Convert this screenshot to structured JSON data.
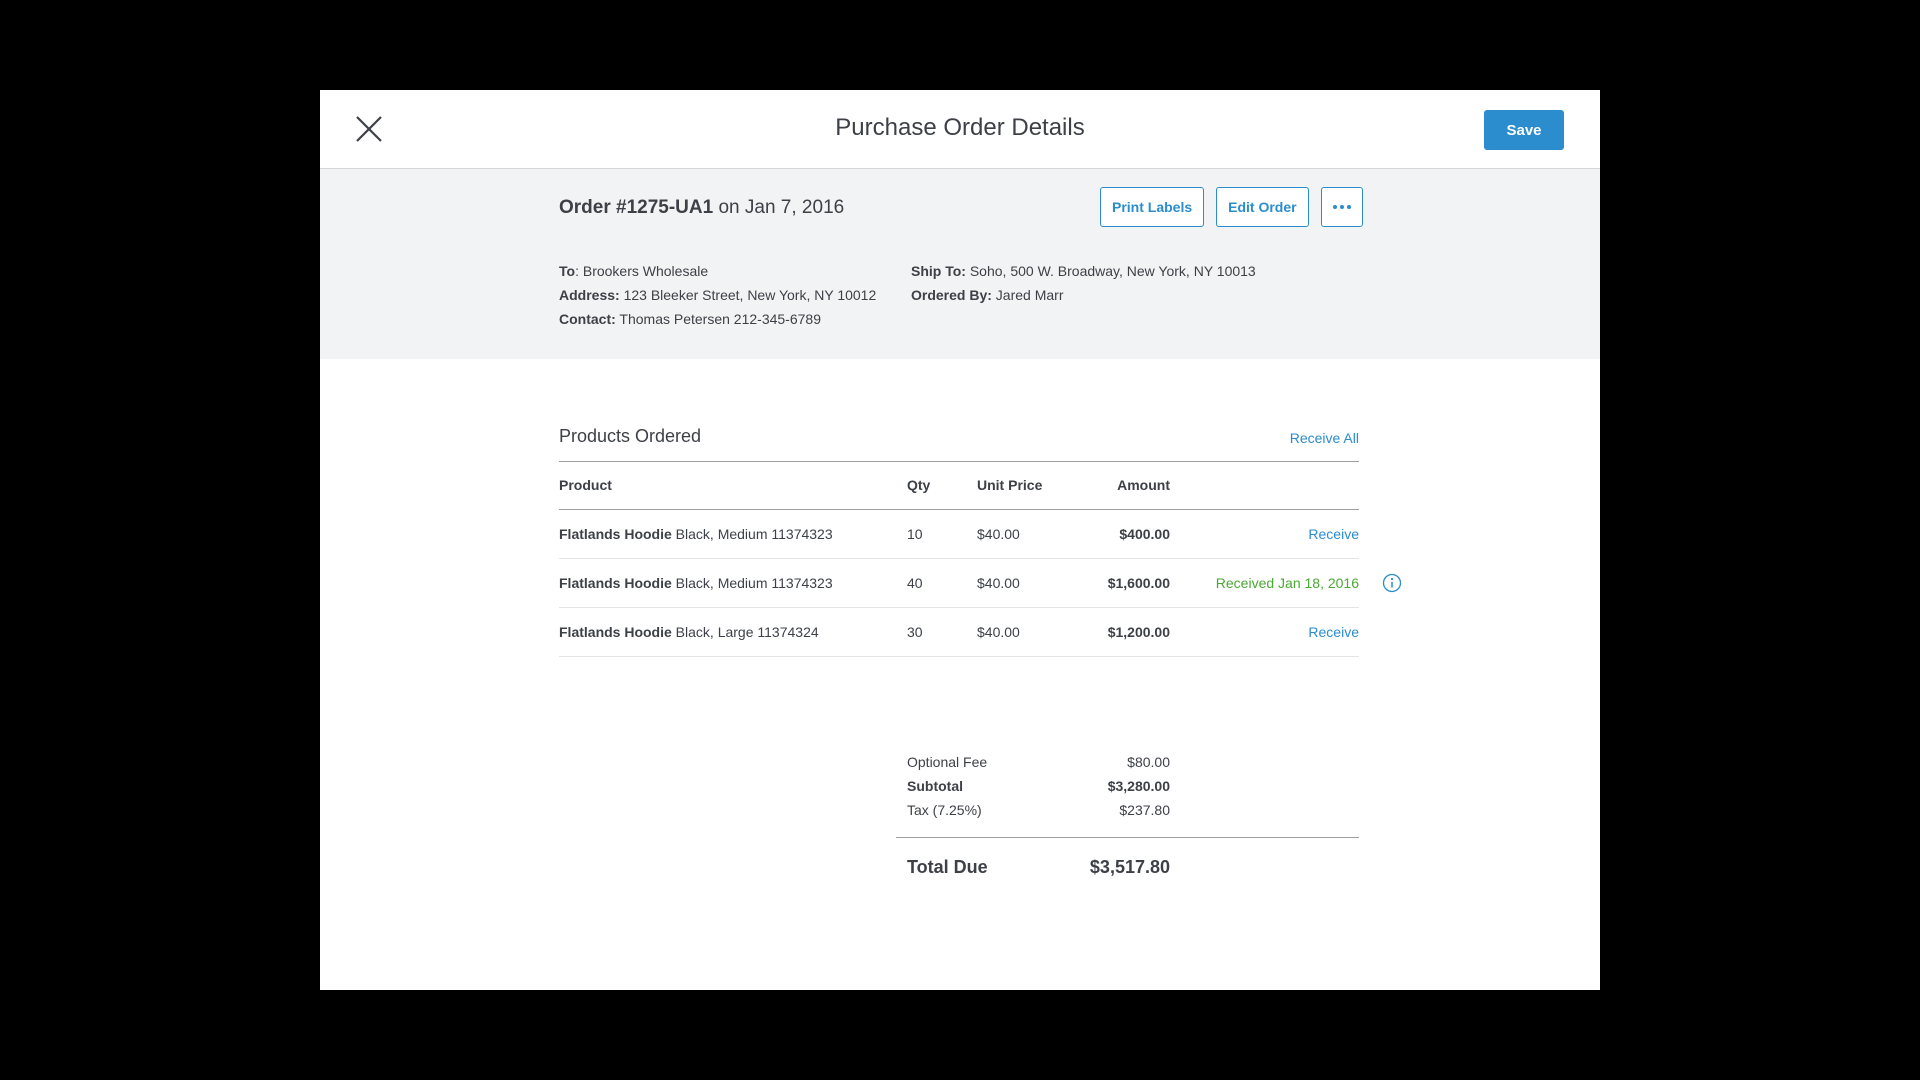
{
  "modal": {
    "title": "Purchase Order Details",
    "save_label": "Save"
  },
  "order": {
    "number": "Order #1275-UA1",
    "date_text": " on Jan 7, 2016",
    "buttons": {
      "print_labels": "Print Labels",
      "edit_order": "Edit Order"
    },
    "details_left": [
      {
        "label": "To",
        "value": ": Brookers Wholesale"
      },
      {
        "label": "Address:",
        "value": " 123 Bleeker Street, New York, NY 10012"
      },
      {
        "label": "Contact:",
        "value": " Thomas Petersen 212-345-6789"
      }
    ],
    "details_right": [
      {
        "label": "Ship To:",
        "value": " Soho, 500 W. Broadway, New York, NY 10013"
      },
      {
        "label": "Ordered By:",
        "value": " Jared Marr"
      }
    ]
  },
  "products": {
    "title": "Products Ordered",
    "receive_all": "Receive All",
    "columns": {
      "product": "Product",
      "qty": "Qty",
      "unit_price": "Unit Price",
      "amount": "Amount"
    },
    "rows": [
      {
        "name": "Flatlands Hoodie",
        "variant": " Black, Medium 11374323",
        "qty": "10",
        "unit_price": "$40.00",
        "amount": "$400.00",
        "action": "Receive"
      },
      {
        "name": "Flatlands Hoodie",
        "variant": " Black, Medium 11374323",
        "qty": "40",
        "unit_price": "$40.00",
        "amount": "$1,600.00",
        "status": "Received Jan 18, 2016"
      },
      {
        "name": "Flatlands Hoodie",
        "variant": " Black, Large 11374324",
        "qty": "30",
        "unit_price": "$40.00",
        "amount": "$1,200.00",
        "action": "Receive"
      }
    ]
  },
  "totals": {
    "optional_fee": {
      "label": "Optional Fee",
      "value": "$80.00"
    },
    "subtotal": {
      "label": "Subtotal",
      "value": "$3,280.00"
    },
    "tax": {
      "label": "Tax (7.25%)",
      "value": "$237.80"
    },
    "total_due": {
      "label": "Total Due",
      "value": "$3,517.80"
    }
  },
  "icons": {
    "close": "close-icon",
    "more": "more-horizontal-icon",
    "info": "info-icon"
  },
  "colors": {
    "accent": "#2b8dce",
    "success": "#4aa833",
    "panel_bg": "#f2f3f4"
  }
}
